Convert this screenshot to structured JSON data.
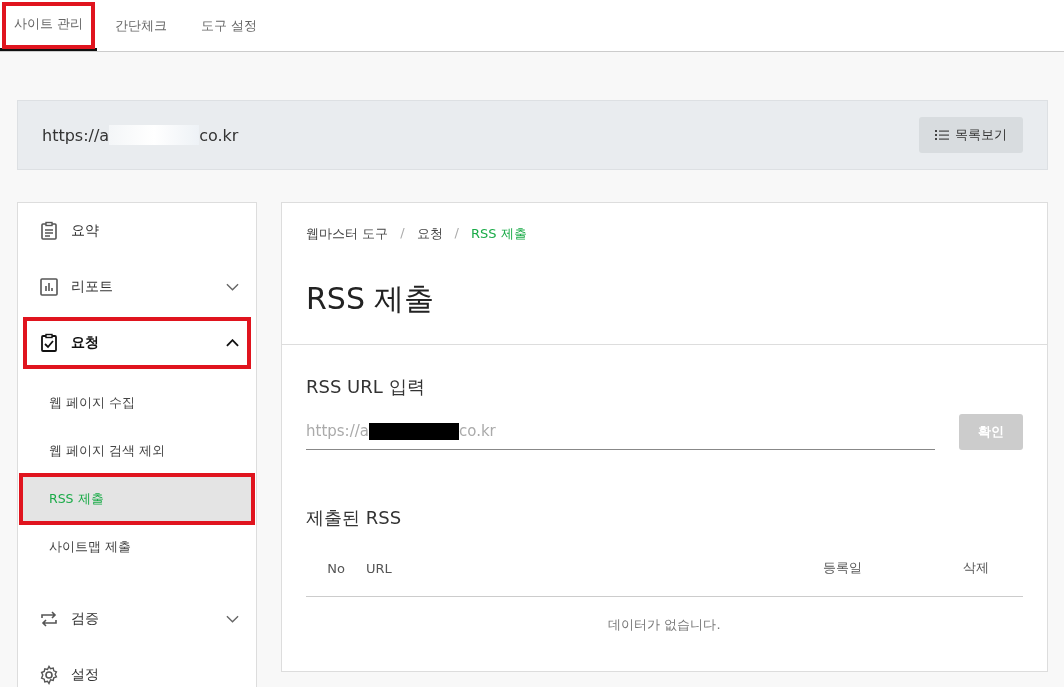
{
  "tabs": [
    {
      "label": "사이트 관리",
      "selected": true,
      "highlighted": true
    },
    {
      "label": "간단체크",
      "selected": false,
      "highlighted": false
    },
    {
      "label": "도구 설정",
      "selected": false,
      "highlighted": false
    }
  ],
  "site": {
    "url_start": "https://a",
    "url_end": "co.kr",
    "list_button": "목록보기"
  },
  "sidebar": {
    "items": [
      {
        "label": "요약",
        "highlighted": false
      },
      {
        "label": "리포트",
        "expanded": false,
        "highlighted": false
      },
      {
        "label": "요청",
        "expanded": true,
        "highlighted": true,
        "children": [
          {
            "label": "웹 페이지 수집",
            "selected": false,
            "highlighted": false
          },
          {
            "label": "웹 페이지 검색 제외",
            "selected": false,
            "highlighted": false
          },
          {
            "label": "RSS 제출",
            "selected": true,
            "highlighted": true
          },
          {
            "label": "사이트맵 제출",
            "selected": false,
            "highlighted": false
          }
        ]
      },
      {
        "label": "검증",
        "expanded": false,
        "highlighted": false
      },
      {
        "label": "설정",
        "highlighted": false
      }
    ]
  },
  "breadcrumb": [
    {
      "kind": "link",
      "text": "웹마스터 도구"
    },
    {
      "kind": "separator",
      "text": "/"
    },
    {
      "kind": "link",
      "text": "요청"
    },
    {
      "kind": "separator",
      "text": "/"
    },
    {
      "kind": "current",
      "text": "RSS 제출"
    }
  ],
  "page_title": "RSS 제출",
  "form": {
    "label": "RSS URL 입력",
    "value_start": "https://a",
    "value_end": "co.kr",
    "button": "확인",
    "button_disabled": true
  },
  "submitted": {
    "title": "제출된 RSS",
    "columns": [
      "No",
      "URL",
      "등록일",
      "삭제"
    ],
    "empty_message": "데이터가 없습니다."
  }
}
